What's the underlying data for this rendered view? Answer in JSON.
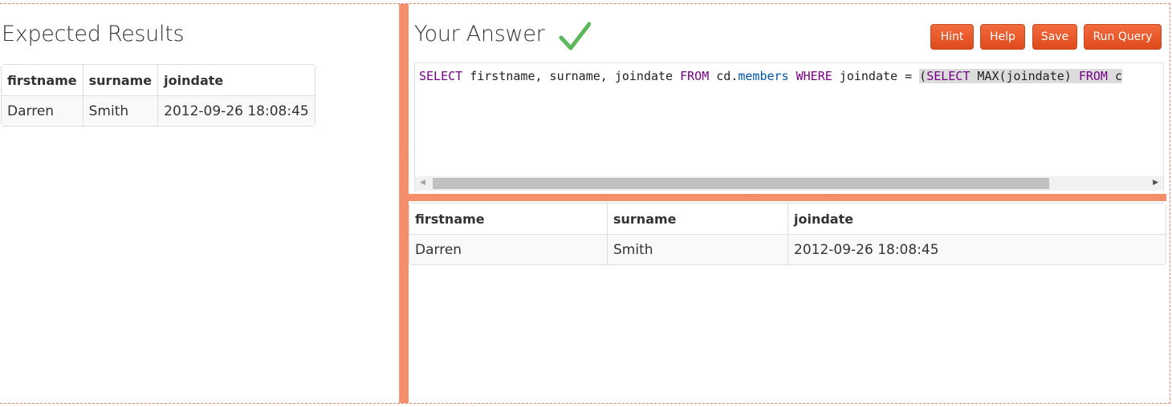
{
  "expected": {
    "title": "Expected Results",
    "columns": [
      "firstname",
      "surname",
      "joindate"
    ],
    "rows": [
      [
        "Darren",
        "Smith",
        "2012-09-26 18:08:45"
      ]
    ]
  },
  "answer": {
    "title": "Your Answer",
    "status_icon": "check-icon",
    "buttons": {
      "hint": "Hint",
      "help": "Help",
      "save": "Save",
      "run": "Run Query"
    },
    "query": {
      "part1": "SELECT",
      "part2": " firstname, surname, joindate ",
      "part3": "FROM",
      "part4": " cd.",
      "part5": "members",
      "part6": " ",
      "part7": "WHERE",
      "part8": " joindate = ",
      "part9": " (",
      "part10": "SELECT",
      "part11": " MAX(joindate) ",
      "part12": "FROM",
      "part13": " c"
    },
    "columns": [
      "firstname",
      "surname",
      "joindate"
    ],
    "rows": [
      [
        "Darren",
        "Smith",
        "2012-09-26 18:08:45"
      ]
    ]
  },
  "colors": {
    "accent": "#f58e6b",
    "button": "#e5532a",
    "keyword": "#770088",
    "variable": "#0055aa"
  }
}
